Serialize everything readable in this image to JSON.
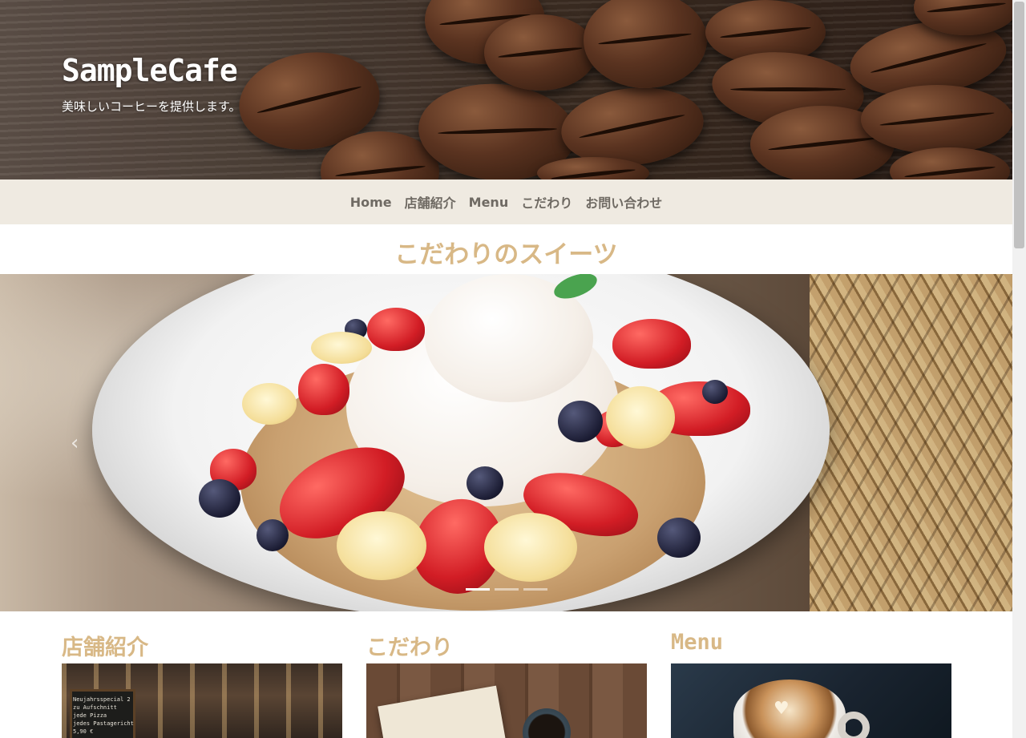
{
  "header": {
    "site_title": "SampleCafe",
    "tagline": "美味しいコーヒーを提供します。"
  },
  "nav": {
    "items": [
      "Home",
      "店舗紹介",
      "Menu",
      "こだわり",
      "お問い合わせ"
    ]
  },
  "sweets": {
    "heading": "こだわりのスイーツ",
    "carousel": {
      "slide_count": 3,
      "active_index": 0
    }
  },
  "cards": [
    {
      "title": "店舗紹介",
      "image": "cafe-street-photo",
      "board_text": "Neujahrsspecial 2\nzu Aufschnitt\njede Pizza\njedes Pastagericht\n5,90 €"
    },
    {
      "title": "こだわり",
      "image": "book-and-coffee-photo"
    },
    {
      "title": "Menu",
      "image": "latte-art-photo"
    }
  ],
  "colors": {
    "accent": "#d8b886",
    "nav_bg": "#efeae1",
    "nav_text": "#6f6a63"
  },
  "icons": {
    "carousel_prev": "chevron-left-icon"
  }
}
